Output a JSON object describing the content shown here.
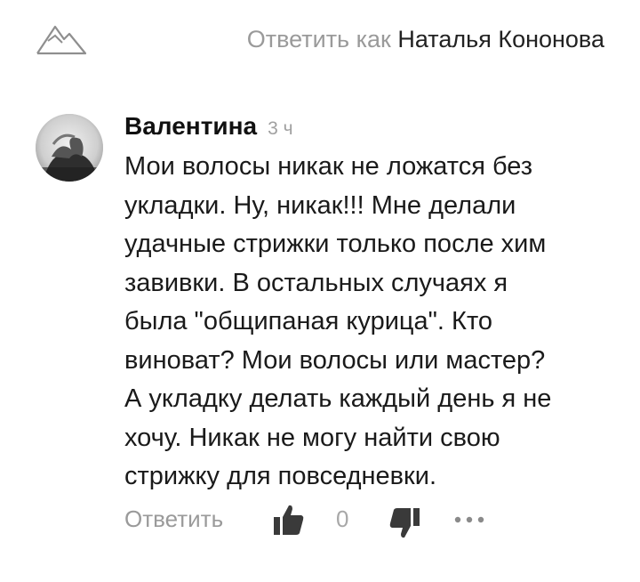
{
  "header": {
    "reply_as_prefix": "Ответить как",
    "user_name": "Наталья Кононова",
    "logo_icon": "mountain-logo-icon"
  },
  "comment": {
    "author": "Валентина",
    "time": "3 ч",
    "lines": [
      "Мои волосы никак не ложатся без",
      "укладки. Ну, никак!!! Мне делали",
      "удачные стрижки только после хим",
      "завивки. В остальных случаях я",
      "была \"общипаная курица\". Кто",
      "виноват? Мои волосы или мастер?",
      "А укладку делать каждый день я не",
      "хочу. Никак не могу найти свою",
      "стрижку для повседневки."
    ],
    "actions": {
      "reply_label": "Ответить",
      "like_count": "0",
      "like_icon": "thumbs-up-icon",
      "dislike_icon": "thumbs-down-icon",
      "more_icon": "more-dots-icon"
    }
  },
  "colors": {
    "muted_text": "#9a9a9a",
    "main_text": "#1a1a1a",
    "icon_dark": "#3a3a3a"
  }
}
